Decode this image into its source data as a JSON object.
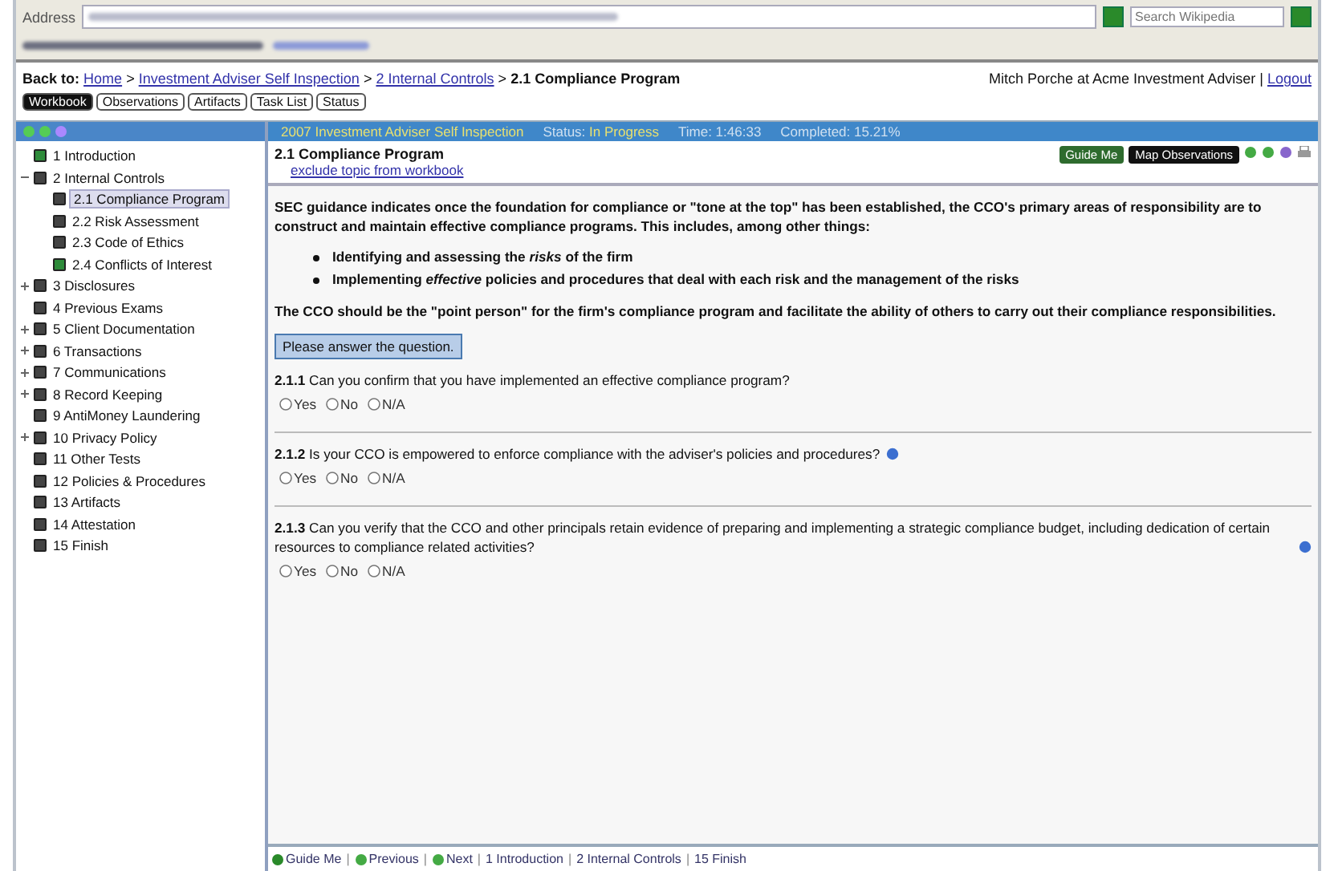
{
  "browser": {
    "address_label": "Address",
    "search": {
      "placeholder": "Search Wikipedia"
    }
  },
  "breadcrumb": {
    "prefix": "Back to:",
    "separator": ">",
    "links": [
      "Home",
      "Investment Adviser Self Inspection",
      "2 Internal Controls"
    ],
    "current": "2.1 Compliance Program"
  },
  "user": {
    "text": "Mitch Porche at Acme Investment Adviser",
    "separator": "|",
    "logout": "Logout"
  },
  "tabs": [
    {
      "label": "Workbook",
      "selected": true
    },
    {
      "label": "Observations",
      "selected": false
    },
    {
      "label": "Artifacts",
      "selected": false
    },
    {
      "label": "Task List",
      "selected": false
    },
    {
      "label": "Status",
      "selected": false
    }
  ],
  "tree": [
    {
      "label": "1 Introduction",
      "color": "#2e8b3a"
    },
    {
      "label": "2 Internal Controls",
      "color": "#444444",
      "expanded": true,
      "children": [
        {
          "label": "2.1 Compliance Program",
          "color": "#444444",
          "selected": true
        },
        {
          "label": "2.2 Risk Assessment",
          "color": "#444444",
          "selected": false
        },
        {
          "label": "2.3 Code of Ethics",
          "color": "#444444",
          "selected": false
        },
        {
          "label": "2.4 Conflicts of Interest",
          "color": "#2e8b3a",
          "selected": false
        }
      ]
    },
    {
      "label": "3 Disclosures",
      "color": "#444444",
      "expanded": false
    },
    {
      "label": "4 Previous Exams",
      "color": "#444444"
    },
    {
      "label": "5 Client Documentation",
      "color": "#444444",
      "expanded": false
    },
    {
      "label": "6 Transactions",
      "color": "#444444",
      "expanded": false
    },
    {
      "label": "7 Communications",
      "color": "#444444",
      "expanded": false
    },
    {
      "label": "8 Record Keeping",
      "color": "#444444",
      "expanded": false
    },
    {
      "label": "9 AntiMoney Laundering",
      "color": "#444444"
    },
    {
      "label": "10 Privacy Policy",
      "color": "#444444",
      "expanded": false
    },
    {
      "label": "11 Other Tests",
      "color": "#444444"
    },
    {
      "label": "12 Policies & Procedures",
      "color": "#444444"
    },
    {
      "label": "13 Artifacts",
      "color": "#444444"
    },
    {
      "label": "14 Attestation",
      "color": "#444444"
    },
    {
      "label": "15 Finish",
      "color": "#444444"
    }
  ],
  "status_bar": {
    "title": "2007 Investment Adviser Self Inspection",
    "status_label": "Status:",
    "status": "In Progress",
    "time": "Time: 1:46:33",
    "completed": "Completed: 15.21%"
  },
  "topic": {
    "title": "2.1 Compliance Program",
    "exclude_link": "exclude topic from workbook",
    "buttons": [
      {
        "label": "Guide Me",
        "kind": "guide"
      },
      {
        "label": "Map Observations",
        "kind": "map"
      }
    ]
  },
  "intro": "SEC guidance indicates once the foundation for compliance or \"tone at the top\" has been established, the CCO's primary areas of responsibility are to construct and maintain effective compliance programs. This includes, among other things:",
  "bullets": [
    "Identifying and assessing the *risks* of the firm",
    "Implementing *effective* policies and procedures that deal with each risk and the management of the risks"
  ],
  "cco_text": "The CCO should be the \"point person\" for the firm's compliance program and facilitate the ability of others to carry out their compliance responsibilities.",
  "notice": "Please answer the question.",
  "questions": [
    {
      "number": "2.1.1",
      "text": "Can you confirm that you have implemented an effective compliance program?",
      "info": false,
      "options": [
        {
          "label": "Yes",
          "selected": false
        },
        {
          "label": "No",
          "selected": false
        },
        {
          "label": "N/A",
          "selected": false
        }
      ]
    },
    {
      "number": "2.1.2",
      "text": "Is your CCO is empowered to enforce compliance with the adviser's policies and procedures?",
      "info": true,
      "options": [
        {
          "label": "Yes",
          "selected": false
        },
        {
          "label": "No",
          "selected": false
        },
        {
          "label": "N/A",
          "selected": false
        }
      ]
    },
    {
      "number": "2.1.3",
      "text": "Can you verify that the CCO and other principals retain evidence of preparing and implementing a strategic compliance budget, including dedication of certain resources to compliance related activities?",
      "info": true,
      "options": [
        {
          "label": "Yes",
          "selected": false
        },
        {
          "label": "No",
          "selected": false
        },
        {
          "label": "N/A",
          "selected": false
        }
      ]
    }
  ],
  "footer_separator": "|",
  "footer": [
    {
      "label": "Guide Me",
      "kind": "guide"
    },
    {
      "label": "Previous",
      "kind": "previous"
    },
    {
      "label": "Next",
      "kind": "next"
    },
    {
      "label": "1 Introduction",
      "kind": "link"
    },
    {
      "label": "2 Internal Controls",
      "kind": "link"
    },
    {
      "label": "15 Finish",
      "kind": "link"
    }
  ]
}
